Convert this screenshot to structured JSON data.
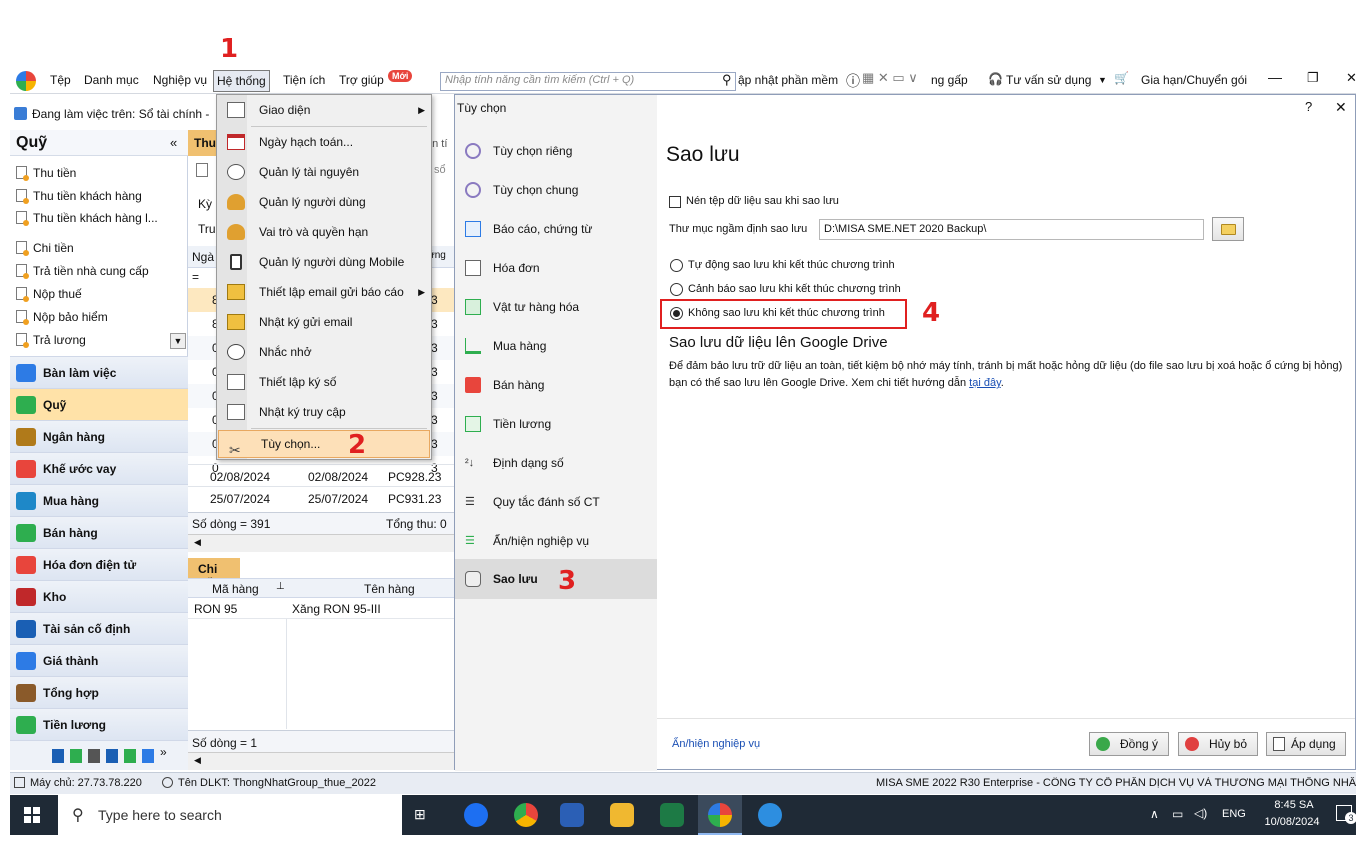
{
  "annotations": {
    "step1": "1",
    "step2": "2",
    "step3": "3",
    "step4": "4"
  },
  "menubar": {
    "items": [
      "Tệp",
      "Danh mục",
      "Nghiệp vụ",
      "Hệ thống",
      "Tiện ích",
      "Trợ giúp"
    ],
    "new_badge": "Mới",
    "search_placeholder": "Nhập tính năng cần tìm kiếm (Ctrl + Q)",
    "update": "ập nhật phần mềm",
    "urgent": "ng gấp",
    "support": "Tư vấn sử dụng",
    "plan": "Gia hạn/Chuyển gói"
  },
  "workspace": {
    "label": "Đang làm việc trên: Sổ tài chính -"
  },
  "sidebar": {
    "title": "Quỹ",
    "collapse": "«",
    "links": [
      "Thu tiền",
      "Thu tiền khách hàng",
      "Thu tiền khách hàng l...",
      "Chi tiền",
      "Trả tiền nhà cung cấp",
      "Nộp thuế",
      "Nộp bảo hiểm",
      "Trả lương"
    ],
    "modules": [
      "Bàn làm việc",
      "Quỹ",
      "Ngân hàng",
      "Khế ước vay",
      "Mua hàng",
      "Bán hàng",
      "Hóa đơn điện tử",
      "Kho",
      "Tài sản cố định",
      "Giá thành",
      "Tổng hợp",
      "Tiền lương"
    ]
  },
  "grid": {
    "tab": "Thu",
    "toolbar_fragment": "Kỳ",
    "toolbar_fragment2": "Tru",
    "col_fragment": "Ngà",
    "rows": [
      {
        "date1": "02/08/2024",
        "date2": "02/08/2024",
        "ref": "PC928.23"
      },
      {
        "date1": "25/07/2024",
        "date2": "25/07/2024",
        "ref": "PC931.23"
      }
    ],
    "row_count": "Số dòng = 391",
    "total": "Tổng thu: 0",
    "detail_tab": "Chi tiết",
    "detail_headers": [
      "Mã hàng",
      "Tên hàng"
    ],
    "detail_rows": [
      {
        "code": "RON 95",
        "name": "Xăng RON 95-III"
      }
    ],
    "detail_count": "Số dòng = 1",
    "partial_values": [
      "3",
      "3",
      "3",
      "3",
      "3",
      "3",
      "3",
      "3"
    ]
  },
  "menu": {
    "items": [
      "Giao diện",
      "Ngày hạch toán...",
      "Quản lý tài nguyên",
      "Quản lý người dùng",
      "Vai trò và quyền hạn",
      "Quản lý người dùng Mobile",
      "Thiết lập email gửi báo cáo",
      "Nhật ký gửi email",
      "Nhắc nhở",
      "Thiết lập ký số",
      "Nhật ký truy cập",
      "Tùy chọn..."
    ]
  },
  "dialog": {
    "title": "Tùy chọn",
    "help": "?",
    "close": "✕",
    "nav": [
      "Tùy chọn riêng",
      "Tùy chọn chung",
      "Báo cáo, chứng từ",
      "Hóa đơn",
      "Vật tư hàng hóa",
      "Mua hàng",
      "Bán hàng",
      "Tiền lương",
      "Định dạng số",
      "Quy tắc đánh số CT",
      "Ẩn/hiện nghiệp vụ",
      "Sao lưu"
    ],
    "heading": "Sao lưu",
    "compress_label": "Nén tệp dữ liệu sau khi sao lưu",
    "folder_label": "Thư mục ngầm định sao lưu",
    "folder_value": "D:\\MISA SME.NET 2020 Backup\\",
    "radios": [
      "Tự động sao lưu khi kết thúc chương trình",
      "Cảnh báo sao lưu khi kết thúc chương trình",
      "Không sao lưu khi kết thúc chương trình"
    ],
    "gdrive_heading": "Sao lưu dữ liệu lên Google Drive",
    "gdrive_text1": "Để đảm bảo lưu trữ dữ liệu an toàn, tiết kiệm bộ nhớ máy tính, tránh bị mất hoặc hỏng dữ liệu (do file sao lưu bị xoá hoặc ổ cứng bị hỏng)",
    "gdrive_text2": "bạn có thể sao lưu lên Google Drive. Xem chi tiết hướng dẫn",
    "gdrive_link": "tại đây",
    "gdrive_end": ".",
    "footer_link": "Ẩn/hiện nghiệp vụ",
    "ok": "Đồng ý",
    "cancel": "Hủy bỏ",
    "apply": "Áp dụng"
  },
  "status": {
    "server": "Máy chủ: 27.73.78.220",
    "db": "Tên DLKT: ThongNhatGroup_thue_2022",
    "product": "MISA SME 2022 R30 Enterprise - CÔNG TY CỔ PHẦN DỊCH VỤ VÀ THƯƠNG MẠI THỐNG NHẤ"
  },
  "taskbar": {
    "search": "Type here to search",
    "lang": "ENG",
    "time": "8:45 SA",
    "date": "10/08/2024",
    "notif": "3"
  }
}
